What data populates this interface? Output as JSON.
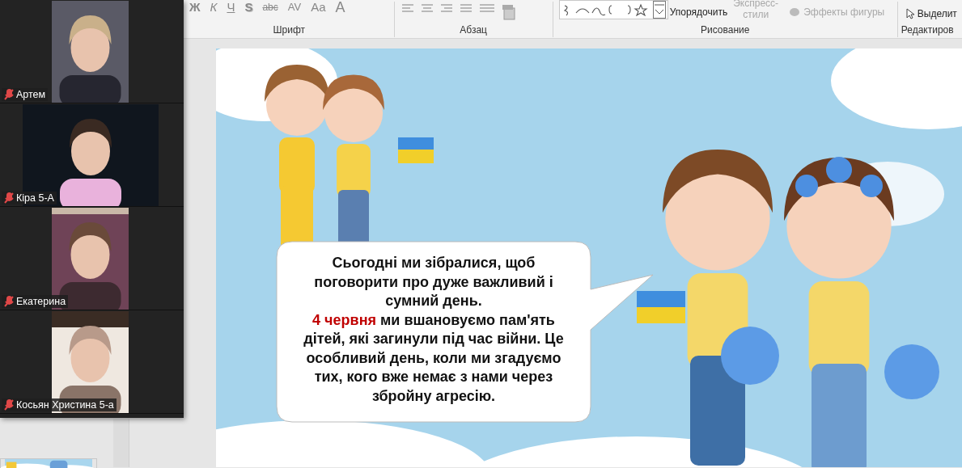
{
  "ribbon": {
    "font": {
      "label": "Шрифт",
      "buttons": [
        {
          "text": "Ж",
          "kind": "bold"
        },
        {
          "text": "К",
          "kind": "italic"
        },
        {
          "text": "Ч",
          "kind": "underline"
        },
        {
          "text": "S",
          "kind": "shadow"
        },
        {
          "text": "abc",
          "kind": "strike"
        },
        {
          "text": "AV",
          "kind": "spacing"
        },
        {
          "text": "Aa",
          "kind": "case"
        },
        {
          "text": "A",
          "kind": "color"
        }
      ]
    },
    "paragraph": {
      "label": "Абзац"
    },
    "drawing": {
      "label": "Рисование",
      "arrange": "Упорядочить",
      "quick_styles": {
        "text": "Экспресс-стили",
        "disabled": true
      },
      "effects": {
        "text": "Эффекты фигуры",
        "disabled": true
      }
    },
    "editing": {
      "label": "Редактиров",
      "select": "Выделит"
    }
  },
  "participants": [
    {
      "name": "Артем",
      "muted": true,
      "kind": "dark"
    },
    {
      "name": "Кіра 5-А",
      "muted": true,
      "kind": "wide"
    },
    {
      "name": "Екатерина",
      "muted": true,
      "kind": "wallpaper"
    },
    {
      "name": "Косьян Христина 5-а",
      "muted": true,
      "kind": "window"
    }
  ],
  "slide": {
    "bubble": [
      {
        "text": "Сьогодні ми зібралися, щоб поговорити про дуже важливий і сумний день.",
        "highlight": false,
        "newline": false
      },
      {
        "text": "4 червня",
        "highlight": true,
        "newline": true
      },
      {
        "text": " ми вшановуємо пам'ять дітей, які загинули під час війни. Це особливий день, коли ми згадуємо тих, кого вже немає з нами через збройну агресію.",
        "highlight": false,
        "newline": false
      }
    ]
  }
}
